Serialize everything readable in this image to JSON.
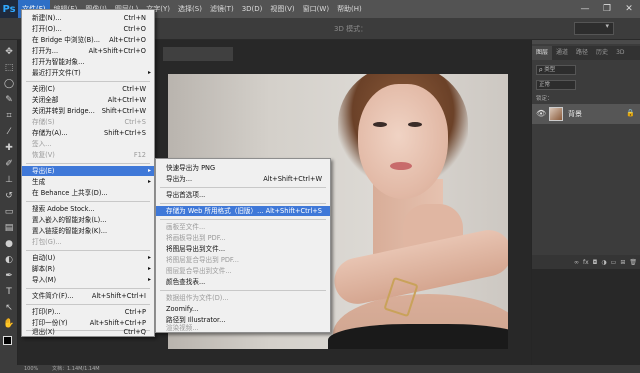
{
  "app": {
    "logo": "Ps"
  },
  "menubar": {
    "items": [
      {
        "label": "文件(F)",
        "active": true
      },
      {
        "label": "编辑(E)"
      },
      {
        "label": "图像(I)"
      },
      {
        "label": "图层(L)"
      },
      {
        "label": "文字(Y)"
      },
      {
        "label": "选择(S)"
      },
      {
        "label": "滤镜(T)"
      },
      {
        "label": "3D(D)"
      },
      {
        "label": "视图(V)"
      },
      {
        "label": "窗口(W)"
      },
      {
        "label": "帮助(H)"
      }
    ],
    "window_controls": [
      "—",
      "❐",
      "✕"
    ]
  },
  "optionsbar": {
    "mode_3d": "3D 模式："
  },
  "file_menu": {
    "items": [
      {
        "label": "新建(N)...",
        "shortcut": "Ctrl+N"
      },
      {
        "label": "打开(O)...",
        "shortcut": "Ctrl+O"
      },
      {
        "label": "在 Bridge 中浏览(B)...",
        "shortcut": "Alt+Ctrl+O"
      },
      {
        "label": "打开为...",
        "shortcut": "Alt+Shift+Ctrl+O"
      },
      {
        "label": "打开为智能对象..."
      },
      {
        "label": "最近打开文件(T)",
        "submenu": true
      },
      {
        "label": "关闭(C)",
        "shortcut": "Ctrl+W"
      },
      {
        "label": "关闭全部",
        "shortcut": "Alt+Ctrl+W"
      },
      {
        "label": "关闭并转到 Bridge...",
        "shortcut": "Shift+Ctrl+W"
      },
      {
        "label": "存储(S)",
        "shortcut": "Ctrl+S",
        "disabled": true
      },
      {
        "label": "存储为(A)...",
        "shortcut": "Shift+Ctrl+S"
      },
      {
        "label": "签入...",
        "disabled": true
      },
      {
        "label": "恢复(V)",
        "shortcut": "F12",
        "disabled": true
      },
      {
        "label": "导出(E)",
        "submenu": true,
        "highlighted": true
      },
      {
        "label": "生成",
        "submenu": true
      },
      {
        "label": "在 Behance 上共享(D)..."
      },
      {
        "label": "搜索 Adobe Stock..."
      },
      {
        "label": "置入嵌入的智能对象(L)..."
      },
      {
        "label": "置入链接的智能对象(K)..."
      },
      {
        "label": "打包(G)...",
        "disabled": true
      },
      {
        "label": "自动(U)",
        "submenu": true
      },
      {
        "label": "脚本(R)",
        "submenu": true
      },
      {
        "label": "导入(M)",
        "submenu": true
      },
      {
        "label": "文件简介(F)...",
        "shortcut": "Alt+Shift+Ctrl+I"
      },
      {
        "label": "打印(P)...",
        "shortcut": "Ctrl+P"
      },
      {
        "label": "打印一份(Y)",
        "shortcut": "Alt+Shift+Ctrl+P"
      },
      {
        "label": "退出(X)",
        "shortcut": "Ctrl+Q"
      }
    ]
  },
  "export_menu": {
    "items": [
      {
        "label": "快速导出为 PNG"
      },
      {
        "label": "导出为...",
        "shortcut": "Alt+Shift+Ctrl+W"
      },
      {
        "label": "导出首选项..."
      },
      {
        "label": "存储为 Web 所用格式（旧版）...",
        "shortcut": "Alt+Shift+Ctrl+S",
        "highlighted": true
      },
      {
        "label": "画板至文件...",
        "disabled": true
      },
      {
        "label": "将画板导出到 PDF...",
        "disabled": true
      },
      {
        "label": "将图层导出到文件...",
        "disabled": false
      },
      {
        "label": "将图层复合导出到 PDF...",
        "disabled": true
      },
      {
        "label": "图层复合导出到文件...",
        "disabled": true
      },
      {
        "label": "颜色查找表..."
      },
      {
        "label": "数据组作为文件(D)...",
        "disabled": true
      },
      {
        "label": "Zoomify..."
      },
      {
        "label": "路径到 Illustrator..."
      },
      {
        "label": "渲染视频...",
        "disabled": true
      }
    ]
  },
  "panel": {
    "tabs": [
      "图层",
      "通道",
      "路径",
      "历史",
      "3D"
    ],
    "kind_filter": "ρ 类型",
    "blend_mode": "正常",
    "lock_label": "锁定：",
    "layer": {
      "name": "背景",
      "lock": "🔒"
    }
  },
  "status": {
    "zoom": "100%",
    "doc_size": "文档：1.14M/1.14M"
  }
}
